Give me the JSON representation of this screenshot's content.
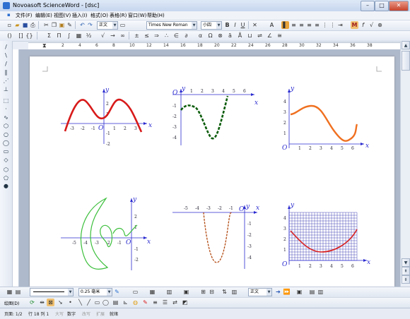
{
  "window": {
    "title": "Novoasoft ScienceWord - [dsc]",
    "minimize": "–",
    "maximize": "□",
    "close": "✕"
  },
  "menu": [
    "文件(F)",
    "编辑(E)",
    "视图(V)",
    "插入(I)",
    "格式(O)",
    "表格(R)",
    "窗口(W)",
    "帮助(H)"
  ],
  "toolbar": {
    "style_combo": "正文",
    "font_combo": "Times New Roman",
    "size_combo": "小四",
    "bold": "B",
    "italic": "I",
    "underline": "U"
  },
  "ruler_numbers": [
    "2",
    "4",
    "6",
    "8",
    "10",
    "12",
    "14",
    "16",
    "18",
    "20",
    "22",
    "24",
    "26",
    "28",
    "30",
    "32",
    "34",
    "36",
    "38"
  ],
  "graphs": {
    "g1": {
      "x_label": "x",
      "y_label": "y",
      "origin": "O",
      "x_ticks": [
        "-3",
        "-2",
        "-1",
        "1",
        "2",
        "3"
      ],
      "y_ticks": [
        "2",
        "1",
        "-1",
        "-2"
      ],
      "color": "#d81a1a"
    },
    "g2": {
      "x_label": "x",
      "y_label": "y",
      "origin": "O",
      "x_ticks": [
        "1",
        "2",
        "3",
        "4",
        "5",
        "6"
      ],
      "y_ticks": [
        "-1",
        "-2",
        "-3",
        "-4"
      ],
      "color": "#0b5c0b"
    },
    "g3": {
      "x_label": "x",
      "y_label": "y",
      "origin": "O",
      "x_ticks": [
        "1",
        "2",
        "3",
        "4",
        "5",
        "6"
      ],
      "y_ticks": [
        "4",
        "3",
        "2",
        "1"
      ],
      "color": "#f07020"
    },
    "g4": {
      "x_label": "x",
      "y_label": "y",
      "origin": "O",
      "x_ticks": [
        "-5",
        "-4",
        "-3",
        "-2",
        "-1"
      ],
      "y_ticks": [
        "2",
        "1",
        "-1",
        "-2"
      ],
      "color": "#3cbf3c"
    },
    "g5": {
      "x_label": "x",
      "y_label": "y",
      "origin": "O",
      "x_ticks": [
        "-5",
        "-4",
        "-3",
        "-2",
        "-1"
      ],
      "y_ticks": [
        "-1",
        "-2",
        "-3",
        "-4"
      ],
      "color": "#b24a12"
    },
    "g6": {
      "x_label": "x",
      "y_label": "y",
      "origin": "O",
      "x_ticks": [
        "1",
        "2",
        "3",
        "4",
        "5",
        "6"
      ],
      "y_ticks": [
        "4",
        "3",
        "2",
        "1"
      ],
      "color": "#d82020",
      "grid_color": "#2222aa"
    }
  },
  "bottom_toolbar": {
    "line_width": "0.25 毫米",
    "style_combo": "正文",
    "draw_label": "绘图(D)"
  },
  "status": {
    "page": "页面: 1/2",
    "line_col": "行 18 列 1",
    "caps": "大写",
    "num": "数字",
    "rewrite": "改写",
    "extend": "扩展",
    "ready": "就绪"
  }
}
